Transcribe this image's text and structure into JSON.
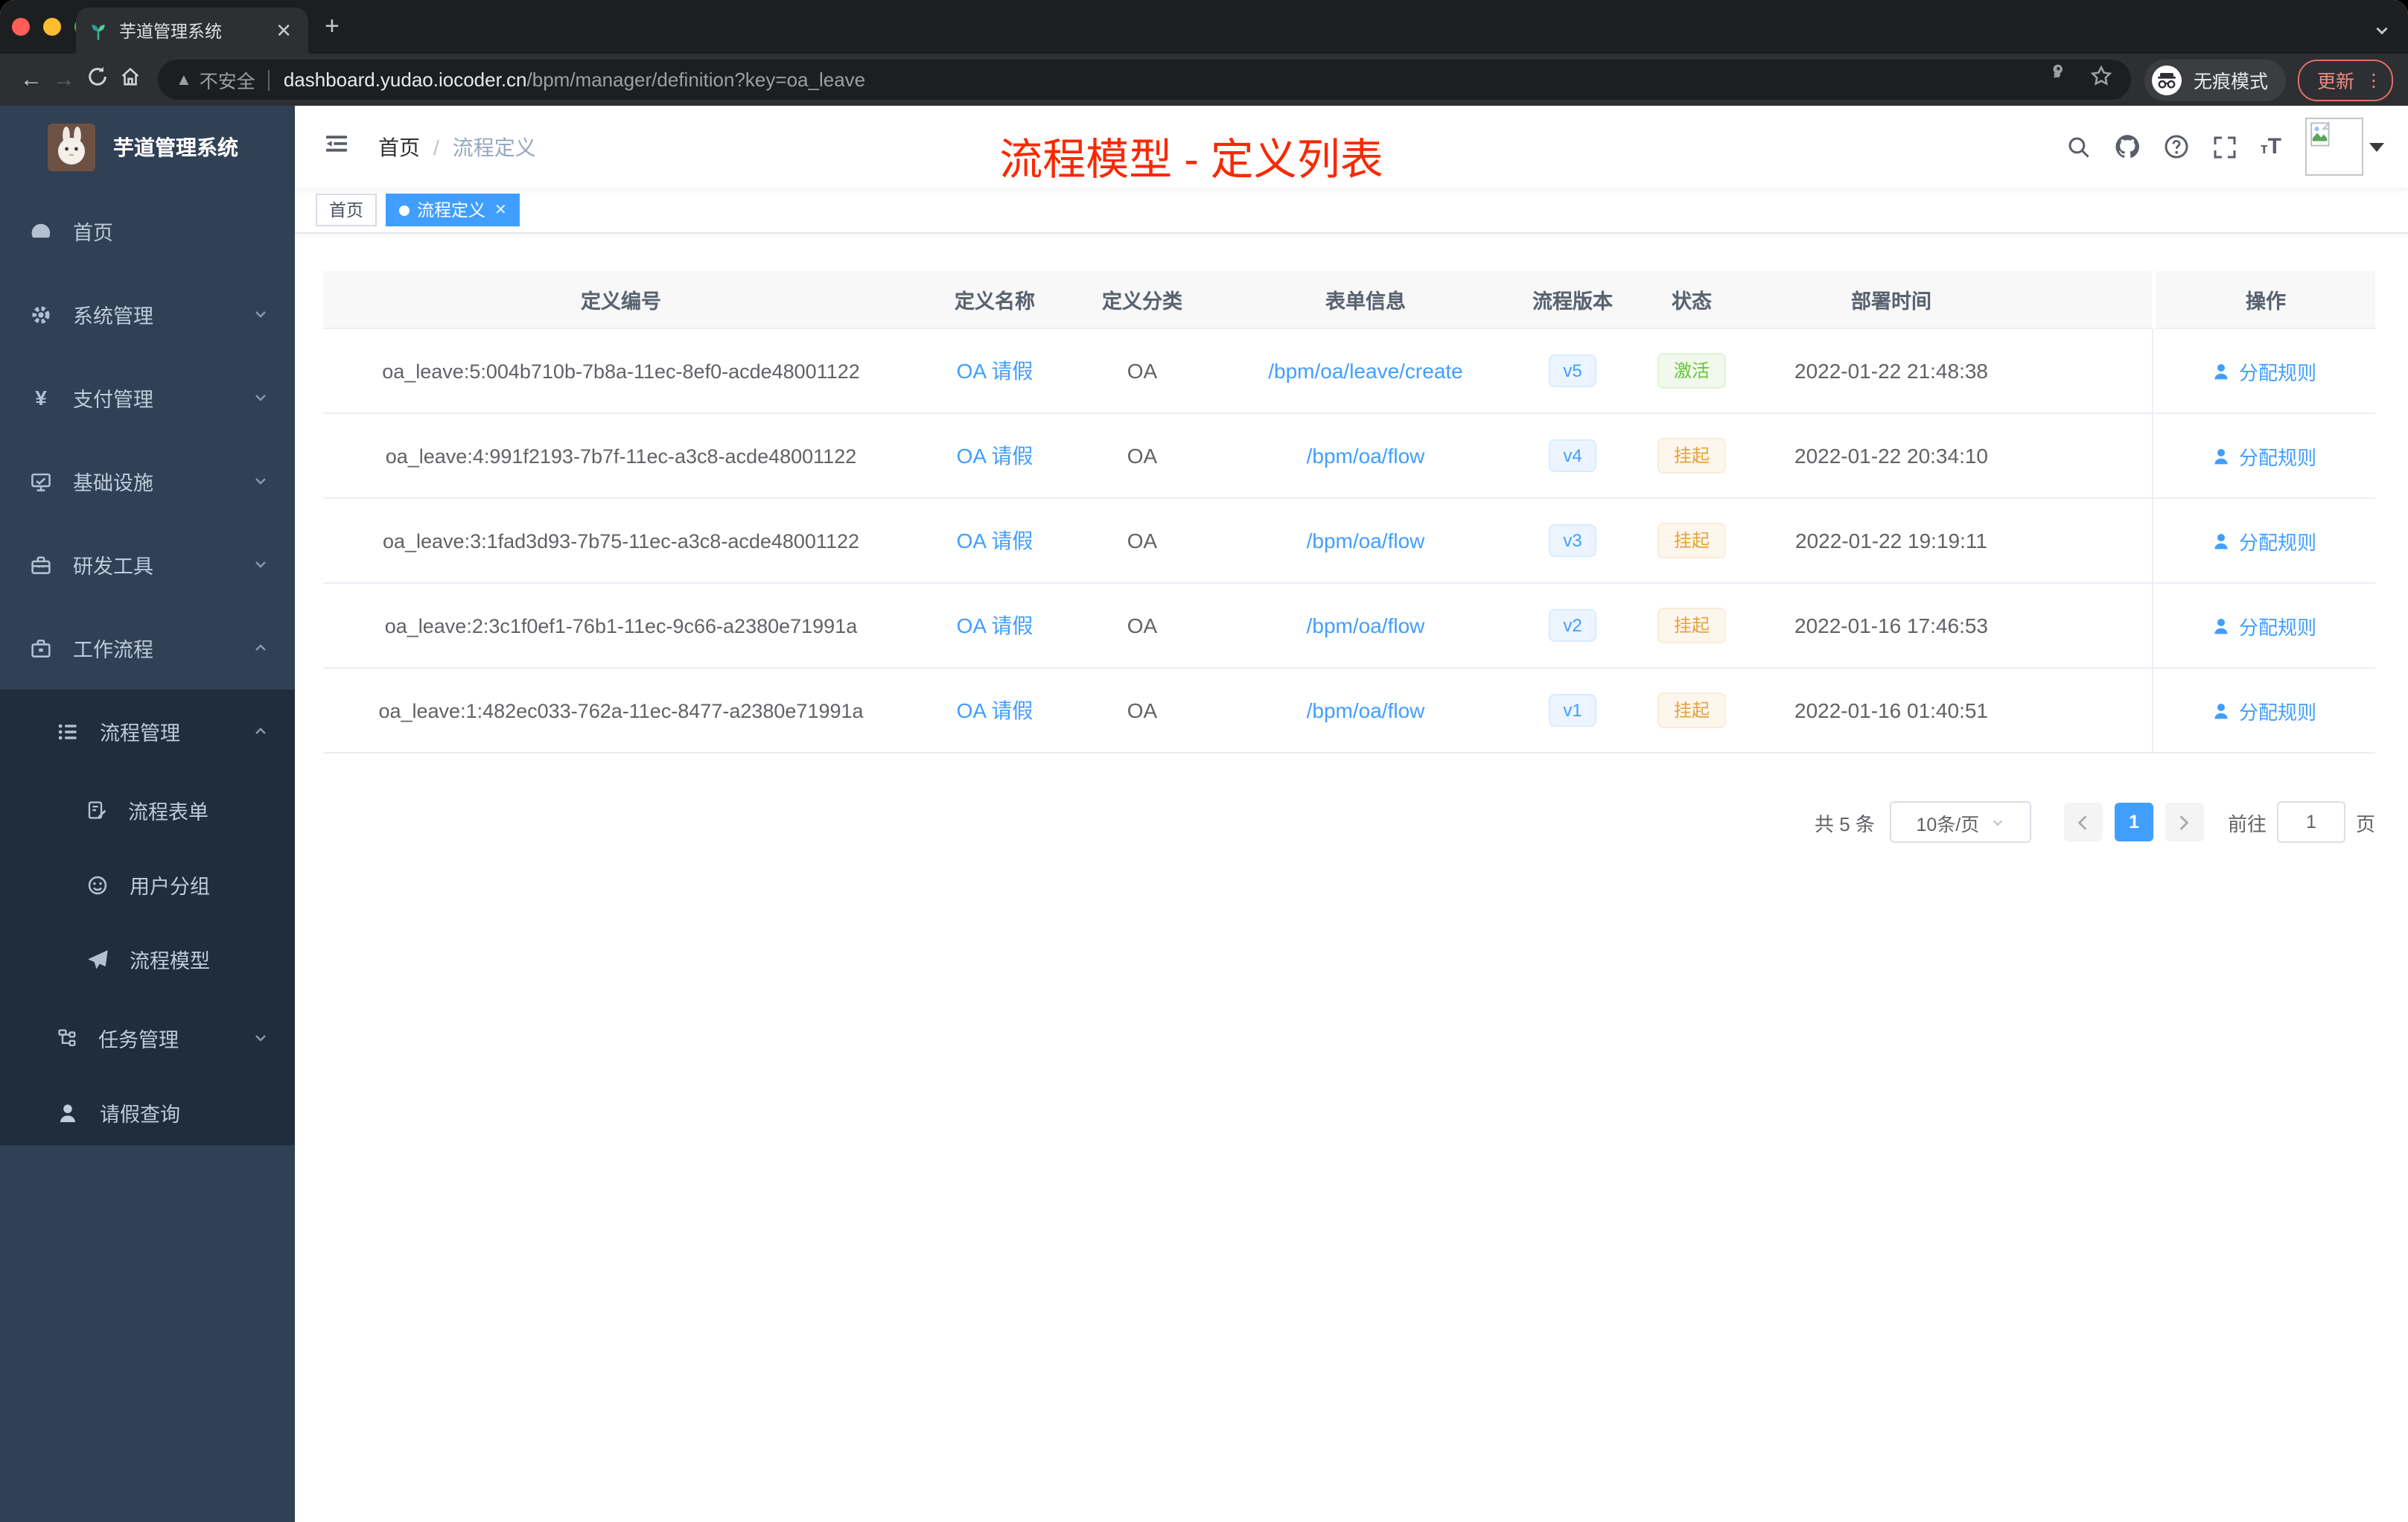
{
  "browser": {
    "tab_title": "芋道管理系统",
    "security_label": "不安全",
    "url_host": "dashboard.yudao.iocoder.cn",
    "url_path": "/bpm/manager/definition?key=oa_leave",
    "incognito_label": "无痕模式",
    "update_label": "更新"
  },
  "sidebar": {
    "logo_title": "芋道管理系统",
    "items": [
      {
        "label": "首页",
        "icon": "dashboard-icon"
      },
      {
        "label": "系统管理",
        "icon": "gear-icon"
      },
      {
        "label": "支付管理",
        "icon": "yen-icon"
      },
      {
        "label": "基础设施",
        "icon": "monitor-icon"
      },
      {
        "label": "研发工具",
        "icon": "toolbox-icon"
      },
      {
        "label": "工作流程",
        "icon": "briefcase-icon"
      }
    ],
    "submenu": [
      {
        "label": "流程管理",
        "icon": "list-icon"
      },
      {
        "label": "流程表单",
        "icon": "form-icon"
      },
      {
        "label": "用户分组",
        "icon": "group-icon"
      },
      {
        "label": "流程模型",
        "icon": "paper-plane-icon"
      },
      {
        "label": "任务管理",
        "icon": "tree-icon"
      },
      {
        "label": "请假查询",
        "icon": "user-icon"
      }
    ]
  },
  "header": {
    "breadcrumb": [
      "首页",
      "流程定义"
    ],
    "annotation": "流程模型 - 定义列表"
  },
  "tags": [
    {
      "label": "首页",
      "active": false
    },
    {
      "label": "流程定义",
      "active": true
    }
  ],
  "table": {
    "columns": [
      "定义编号",
      "定义名称",
      "定义分类",
      "表单信息",
      "流程版本",
      "状态",
      "部署时间",
      "操作"
    ],
    "rows": [
      {
        "id": "oa_leave:5:004b710b-7b8a-11ec-8ef0-acde48001122",
        "name": "OA 请假",
        "category": "OA",
        "form": "/bpm/oa/leave/create",
        "version": "v5",
        "status": "激活",
        "deployed_at": "2022-01-22 21:48:38",
        "action": "分配规则"
      },
      {
        "id": "oa_leave:4:991f2193-7b7f-11ec-a3c8-acde48001122",
        "name": "OA 请假",
        "category": "OA",
        "form": "/bpm/oa/flow",
        "version": "v4",
        "status": "挂起",
        "deployed_at": "2022-01-22 20:34:10",
        "action": "分配规则"
      },
      {
        "id": "oa_leave:3:1fad3d93-7b75-11ec-a3c8-acde48001122",
        "name": "OA 请假",
        "category": "OA",
        "form": "/bpm/oa/flow",
        "version": "v3",
        "status": "挂起",
        "deployed_at": "2022-01-22 19:19:11",
        "action": "分配规则"
      },
      {
        "id": "oa_leave:2:3c1f0ef1-76b1-11ec-9c66-a2380e71991a",
        "name": "OA 请假",
        "category": "OA",
        "form": "/bpm/oa/flow",
        "version": "v2",
        "status": "挂起",
        "deployed_at": "2022-01-16 17:46:53",
        "action": "分配规则"
      },
      {
        "id": "oa_leave:1:482ec033-762a-11ec-8477-a2380e71991a",
        "name": "OA 请假",
        "category": "OA",
        "form": "/bpm/oa/flow",
        "version": "v1",
        "status": "挂起",
        "deployed_at": "2022-01-16 01:40:51",
        "action": "分配规则"
      }
    ]
  },
  "pagination": {
    "total": "共 5 条",
    "page_size": "10条/页",
    "current_page": "1",
    "goto_label": "前往",
    "goto_value": "1",
    "page_unit": "页"
  },
  "colors": {
    "accent": "#409eff",
    "status_active": "#67c23a",
    "status_suspended": "#e6a23c",
    "annotation_red": "#fa2800",
    "sidebar_bg": "#304156",
    "submenu_bg": "#1f2d3d"
  }
}
